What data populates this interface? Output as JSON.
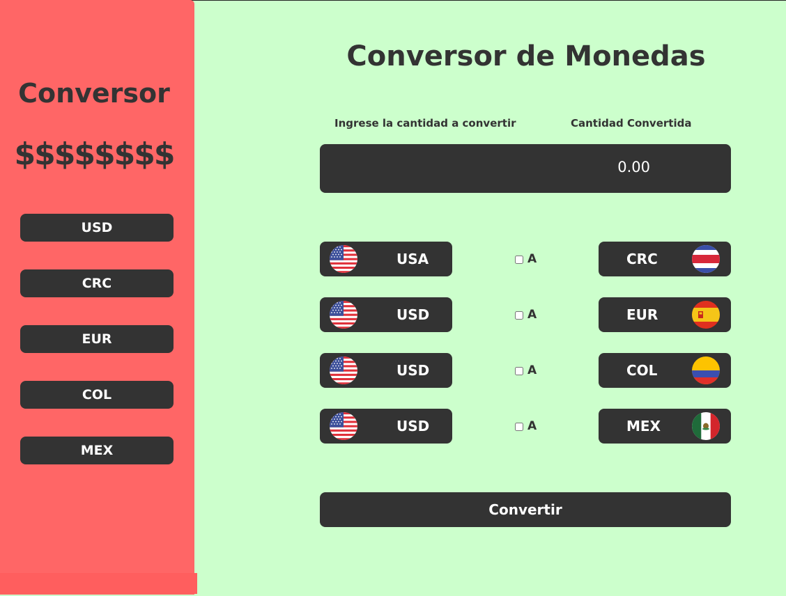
{
  "sidebar": {
    "brand": "Conversor",
    "dollars": "$$$$$$$$",
    "buttons": [
      "USD",
      "CRC",
      "EUR",
      "COL",
      "MEX"
    ]
  },
  "main": {
    "title": "Conversor de Monedas",
    "input_label": "Ingrese la cantidad a convertir",
    "output_label": "Cantidad Convertida",
    "amount_value": "",
    "result": "0.00",
    "pairs": [
      {
        "from": "USA",
        "to": "CRC",
        "sep": "A",
        "from_flag": "usa-flag-icon",
        "to_flag": "costa-rica-flag-icon"
      },
      {
        "from": "USD",
        "to": "EUR",
        "sep": "A",
        "from_flag": "usa-flag-icon",
        "to_flag": "spain-flag-icon"
      },
      {
        "from": "USD",
        "to": "COL",
        "sep": "A",
        "from_flag": "usa-flag-icon",
        "to_flag": "colombia-flag-icon"
      },
      {
        "from": "USD",
        "to": "MEX",
        "sep": "A",
        "from_flag": "usa-flag-icon",
        "to_flag": "mexico-flag-icon"
      }
    ],
    "convert_label": "Convertir"
  },
  "colors": {
    "sidebar_bg": "#ff6666",
    "main_bg": "#ccffcc",
    "button_bg": "#333333",
    "text_light": "#ffffff"
  }
}
